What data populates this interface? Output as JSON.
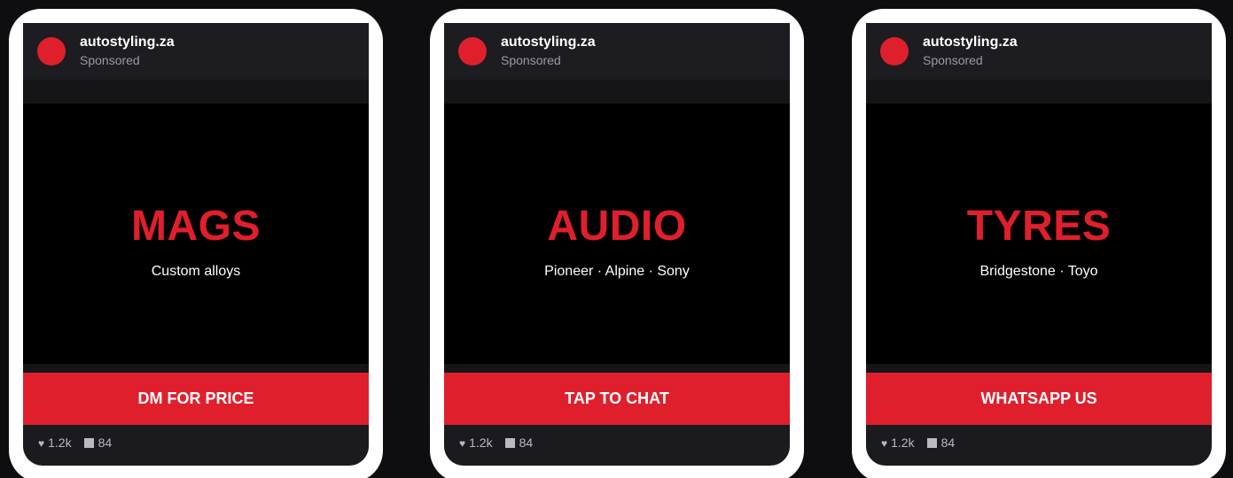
{
  "cards": [
    {
      "account": "autostyling.za",
      "sponsored": "Sponsored",
      "headline": "MAGS",
      "subline": "Custom alloys",
      "cta": "DM FOR PRICE",
      "likes": "1.2k",
      "comments": "84"
    },
    {
      "account": "autostyling.za",
      "sponsored": "Sponsored",
      "headline": "AUDIO",
      "subline": "Pioneer · Alpine · Sony",
      "cta": "TAP TO CHAT",
      "likes": "1.2k",
      "comments": "84"
    },
    {
      "account": "autostyling.za",
      "sponsored": "Sponsored",
      "headline": "TYRES",
      "subline": "Bridgestone · Toyo",
      "cta": "WHATSAPP US",
      "likes": "1.2k",
      "comments": "84"
    }
  ],
  "icons": {
    "like": "heart-icon",
    "comment": "comment-icon"
  },
  "colors": {
    "accent": "#e01f2d",
    "frame": "#ffffff",
    "background": "#0e0e10",
    "card": "#1b1b1f",
    "media": "#000000"
  }
}
